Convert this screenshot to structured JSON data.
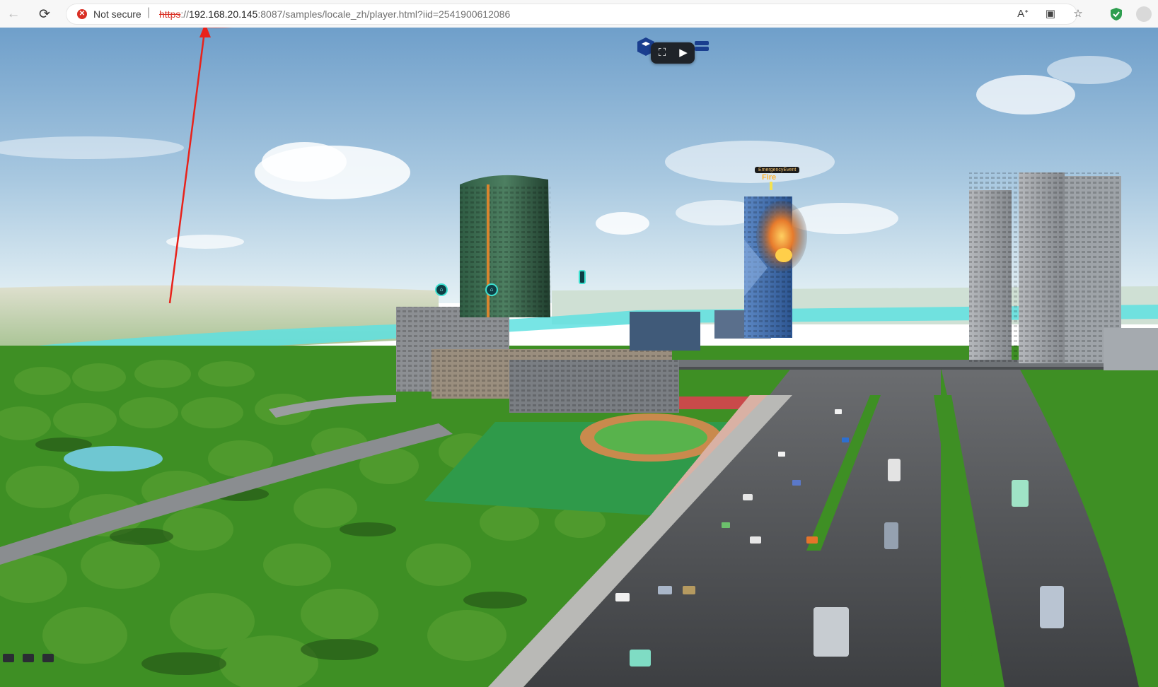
{
  "browser": {
    "security_label": "Not secure",
    "separator": "|",
    "url_scheme": "https",
    "url_host": "192.168.20.145",
    "url_rest": ":8087/samples/locale_zh/player.html?iid=2541900612086",
    "icons": {
      "back": "back-arrow-icon",
      "reload": "reload-icon",
      "insecure": "insecure-warning-icon",
      "readaloud": "read-aloud-icon",
      "app": "app-available-icon",
      "favorite": "star-icon",
      "extension": "shield-extension-icon",
      "profile": "profile-icon"
    }
  },
  "scene": {
    "annotation_color": "#e8221b",
    "fire_tag": "EmergencyEvent",
    "fire_label": "Fire",
    "sky_top": "#6f9fca",
    "sky_bottom": "#dcecf3",
    "water_color": "#5fe0e0",
    "grass_color": "#3e8f24"
  },
  "player_controls": {
    "icons": [
      "cube-logo-icon",
      "fullscreen-exit-icon",
      "play-record-icon",
      "layers-icon"
    ]
  }
}
